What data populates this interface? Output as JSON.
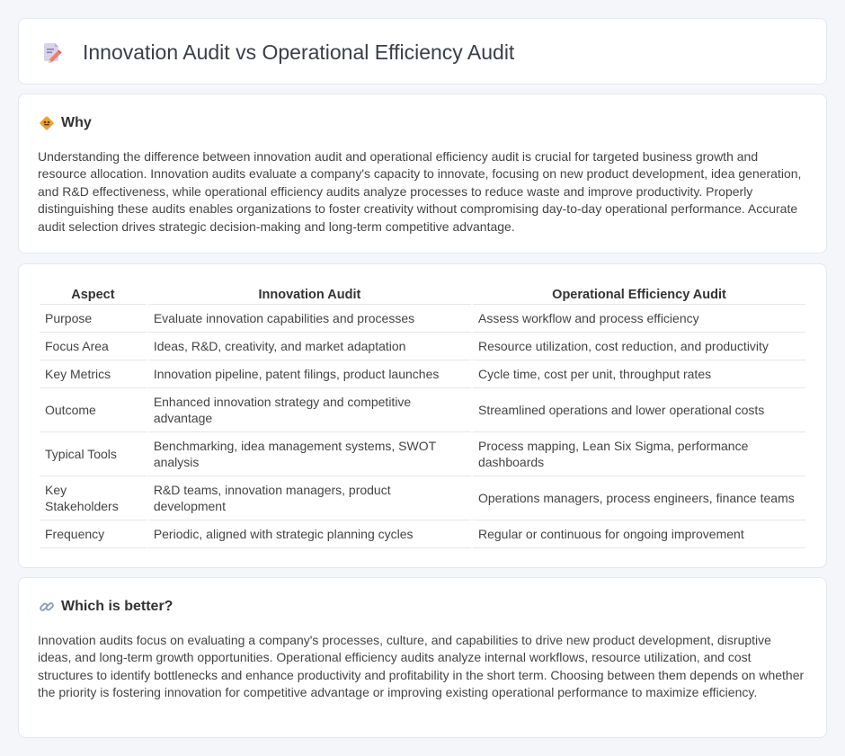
{
  "page": {
    "title": "Innovation Audit vs Operational Efficiency Audit",
    "title_icon": "document-pencil-icon"
  },
  "why": {
    "heading": "Why",
    "icon": "diamond-sign-icon",
    "body": "Understanding the difference between innovation audit and operational efficiency audit is crucial for targeted business growth and resource allocation. Innovation audits evaluate a company's capacity to innovate, focusing on new product development, idea generation, and R&D effectiveness, while operational efficiency audits analyze processes to reduce waste and improve productivity. Properly distinguishing these audits enables organizations to foster creativity without compromising day-to-day operational performance. Accurate audit selection drives strategic decision-making and long-term competitive advantage."
  },
  "comparison": {
    "headers": [
      "Aspect",
      "Innovation Audit",
      "Operational Efficiency Audit"
    ],
    "rows": [
      [
        "Purpose",
        "Evaluate innovation capabilities and processes",
        "Assess workflow and process efficiency"
      ],
      [
        "Focus Area",
        "Ideas, R&D, creativity, and market adaptation",
        "Resource utilization, cost reduction, and productivity"
      ],
      [
        "Key Metrics",
        "Innovation pipeline, patent filings, product launches",
        "Cycle time, cost per unit, throughput rates"
      ],
      [
        "Outcome",
        "Enhanced innovation strategy and competitive advantage",
        "Streamlined operations and lower operational costs"
      ],
      [
        "Typical Tools",
        "Benchmarking, idea management systems, SWOT analysis",
        "Process mapping, Lean Six Sigma, performance dashboards"
      ],
      [
        "Key Stakeholders",
        "R&D teams, innovation managers, product development",
        "Operations managers, process engineers, finance teams"
      ],
      [
        "Frequency",
        "Periodic, aligned with strategic planning cycles",
        "Regular or continuous for ongoing improvement"
      ]
    ]
  },
  "better": {
    "heading": "Which is better?",
    "icon": "link-icon",
    "body": "Innovation audits focus on evaluating a company's processes, culture, and capabilities to drive new product development, disruptive ideas, and long-term growth opportunities. Operational efficiency audits analyze internal workflows, resource utilization, and cost structures to identify bottlenecks and enhance productivity and profitability in the short term. Choosing between them depends on whether the priority is fostering innovation for competitive advantage or improving existing operational performance to maximize efficiency."
  },
  "colors": {
    "background": "#f4f6fa",
    "card": "#ffffff",
    "accent_orange": "#f0a030"
  }
}
